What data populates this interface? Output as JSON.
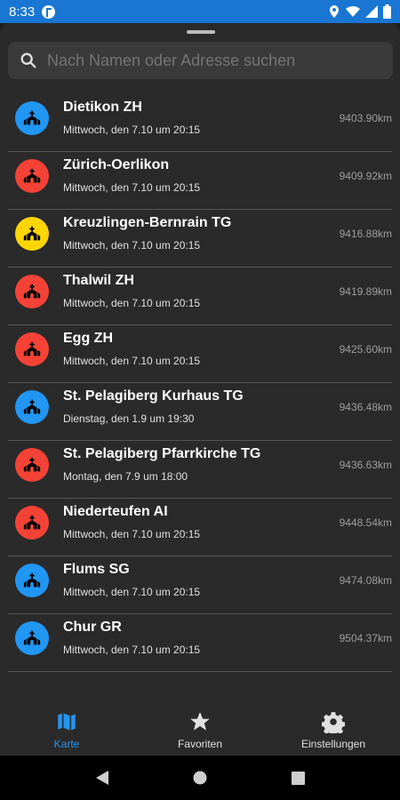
{
  "status_bar": {
    "time": "8:33",
    "icons": [
      "location-icon",
      "wifi-icon",
      "signal-icon",
      "battery-icon"
    ]
  },
  "search": {
    "placeholder": "Nach Namen oder Adresse suchen"
  },
  "colors": {
    "blue": "#2196f3",
    "red": "#f44336",
    "yellow": "#ffd600"
  },
  "locations": [
    {
      "name": "Dietikon ZH",
      "date": "Mittwoch, den 7.10 um 20:15",
      "distance": "9403.90km",
      "color": "blue"
    },
    {
      "name": "Zürich-Oerlikon",
      "date": "Mittwoch, den 7.10 um 20:15",
      "distance": "9409.92km",
      "color": "red"
    },
    {
      "name": "Kreuzlingen-Bernrain TG",
      "date": "Mittwoch, den 7.10 um 20:15",
      "distance": "9416.88km",
      "color": "yellow"
    },
    {
      "name": "Thalwil ZH",
      "date": "Mittwoch, den 7.10 um 20:15",
      "distance": "9419.89km",
      "color": "red"
    },
    {
      "name": "Egg ZH",
      "date": "Mittwoch, den 7.10 um 20:15",
      "distance": "9425.60km",
      "color": "red"
    },
    {
      "name": "St. Pelagiberg Kurhaus TG",
      "date": "Dienstag, den 1.9 um 19:30",
      "distance": "9436.48km",
      "color": "blue"
    },
    {
      "name": "St. Pelagiberg Pfarrkirche TG",
      "date": "Montag, den 7.9 um 18:00",
      "distance": "9436.63km",
      "color": "red"
    },
    {
      "name": "Niederteufen AI",
      "date": "Mittwoch, den 7.10 um 20:15",
      "distance": "9448.54km",
      "color": "red"
    },
    {
      "name": "Flums SG",
      "date": "Mittwoch, den 7.10 um 20:15",
      "distance": "9474.08km",
      "color": "blue"
    },
    {
      "name": "Chur GR",
      "date": "Mittwoch, den 7.10 um 20:15",
      "distance": "9504.37km",
      "color": "blue"
    }
  ],
  "bottom_nav": [
    {
      "label": "Karte",
      "icon": "map-icon",
      "active": true
    },
    {
      "label": "Favoriten",
      "icon": "star-icon",
      "active": false
    },
    {
      "label": "Einstellungen",
      "icon": "gear-icon",
      "active": false
    }
  ]
}
